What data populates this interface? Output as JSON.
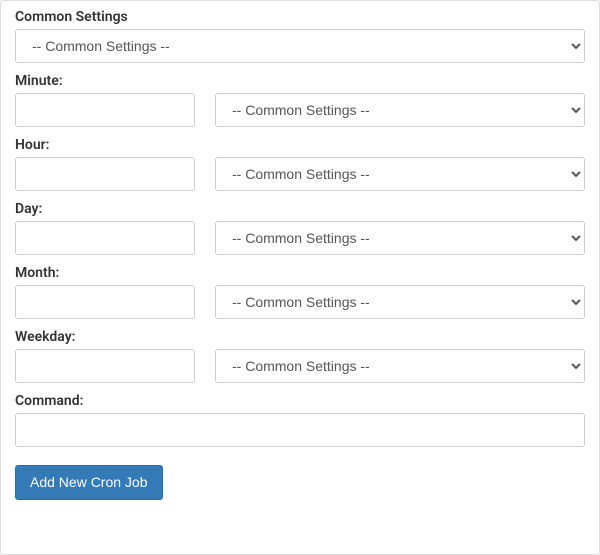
{
  "common_settings": {
    "label": "Common Settings",
    "selected": "-- Common Settings --"
  },
  "fields": {
    "minute": {
      "label": "Minute:",
      "value": "",
      "preset_selected": "-- Common Settings --"
    },
    "hour": {
      "label": "Hour:",
      "value": "",
      "preset_selected": "-- Common Settings --"
    },
    "day": {
      "label": "Day:",
      "value": "",
      "preset_selected": "-- Common Settings --"
    },
    "month": {
      "label": "Month:",
      "value": "",
      "preset_selected": "-- Common Settings --"
    },
    "weekday": {
      "label": "Weekday:",
      "value": "",
      "preset_selected": "-- Common Settings --"
    }
  },
  "command": {
    "label": "Command:",
    "value": ""
  },
  "submit": {
    "label": "Add New Cron Job"
  }
}
